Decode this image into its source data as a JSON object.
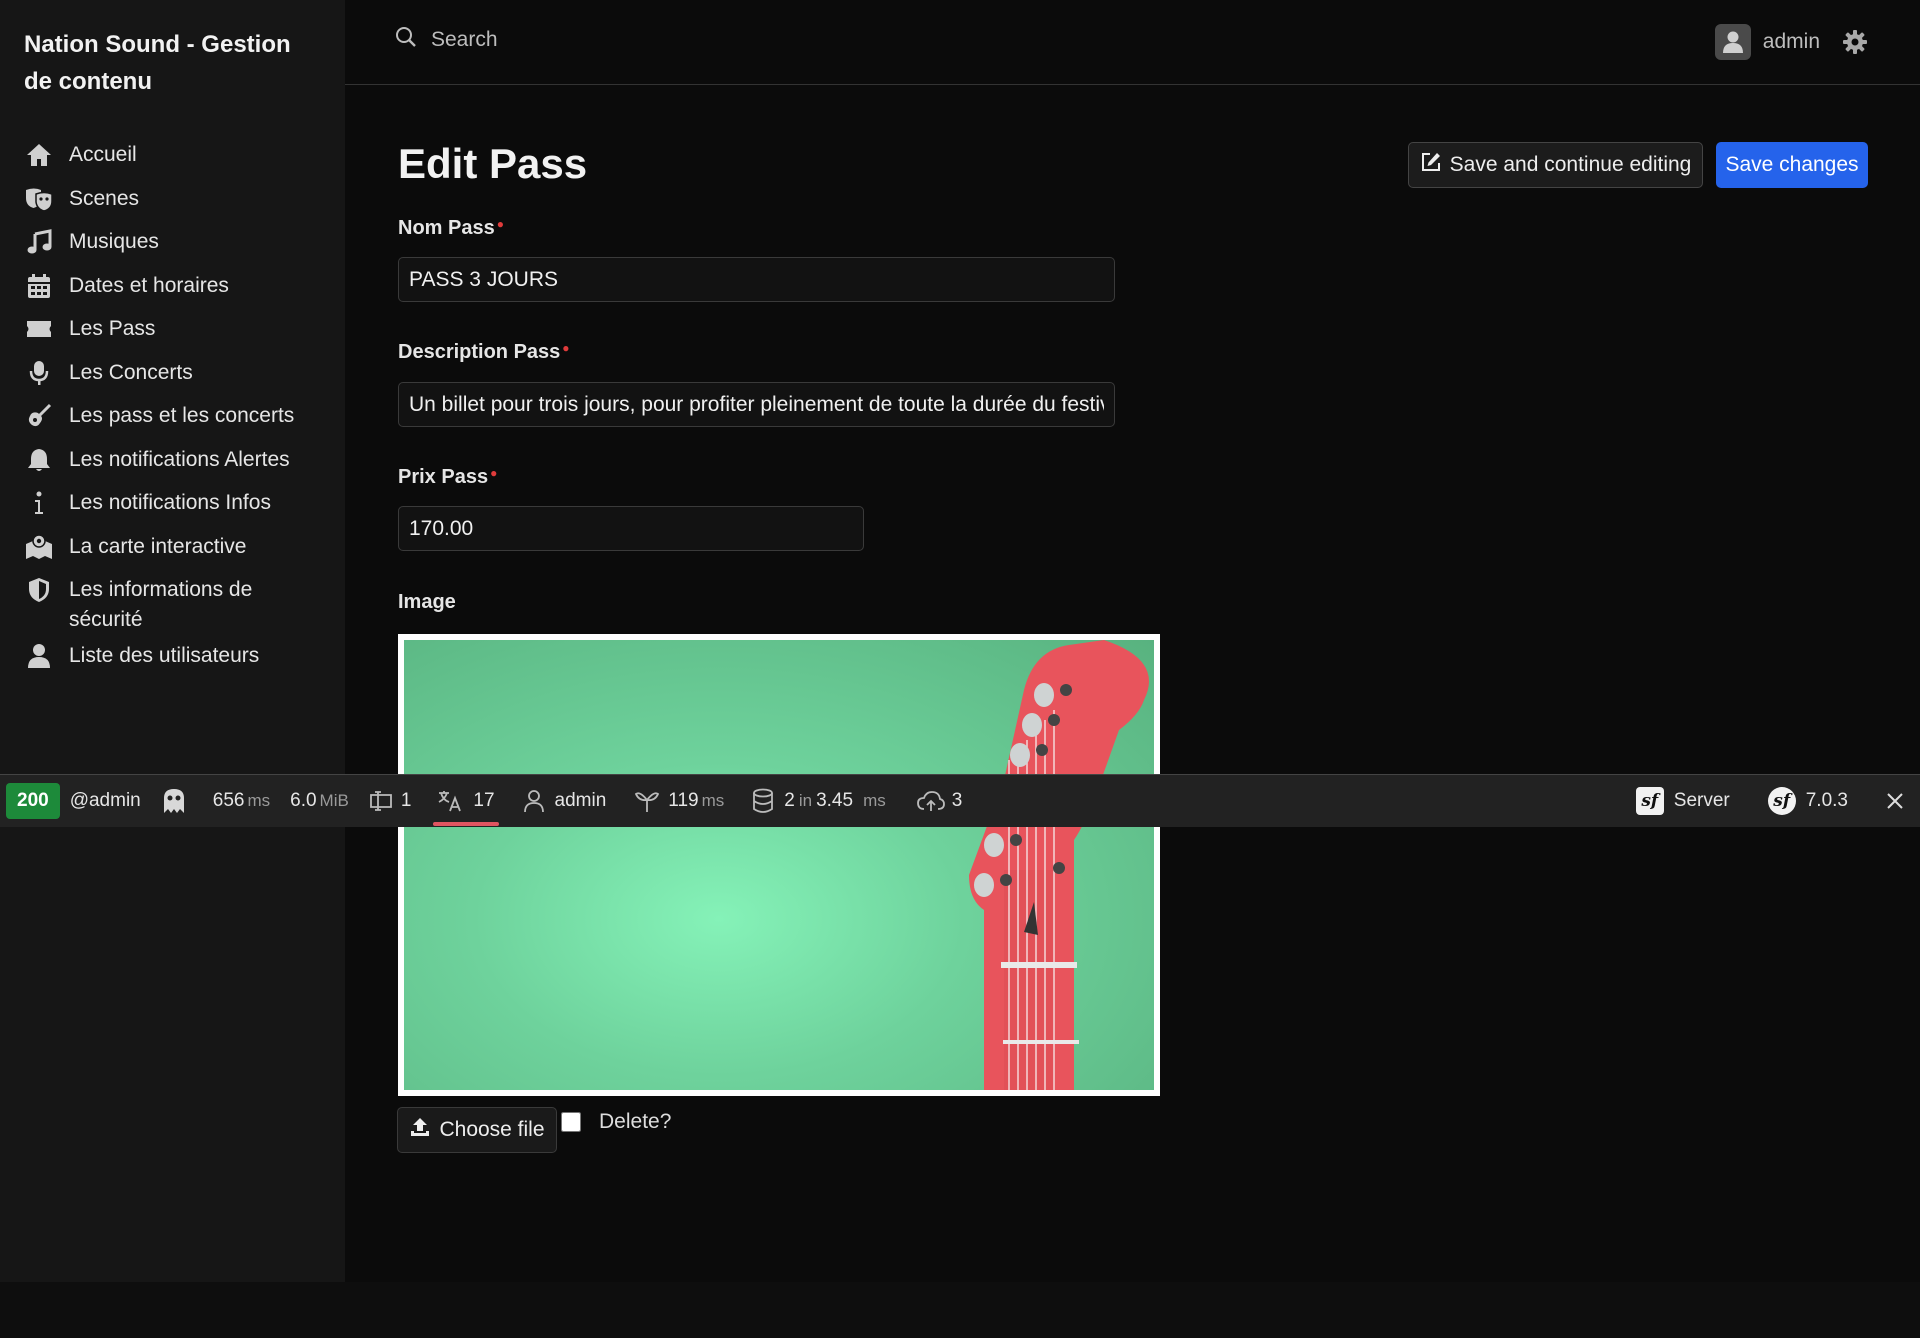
{
  "sidebar": {
    "brand": "Nation Sound - Gestion de contenu",
    "items": [
      {
        "label": "Accueil",
        "icon": "home-icon"
      },
      {
        "label": "Scenes",
        "icon": "masks-icon"
      },
      {
        "label": "Musiques",
        "icon": "music-icon"
      },
      {
        "label": "Dates et horaires",
        "icon": "calendar-icon"
      },
      {
        "label": "Les Pass",
        "icon": "ticket-icon"
      },
      {
        "label": "Les Concerts",
        "icon": "microphone-icon"
      },
      {
        "label": "Les pass et les concerts",
        "icon": "guitar-icon"
      },
      {
        "label": "Les notifications Alertes",
        "icon": "bell-icon"
      },
      {
        "label": "Les notifications Infos",
        "icon": "info-icon"
      },
      {
        "label": "La carte interactive",
        "icon": "map-location-icon"
      },
      {
        "label": "Les informations de sécurité",
        "icon": "shield-icon"
      },
      {
        "label": "Liste des utilisateurs",
        "icon": "user-icon"
      }
    ]
  },
  "header": {
    "search_placeholder": "Search",
    "username": "admin"
  },
  "page": {
    "title": "Edit Pass",
    "save_continue_label": "Save and continue editing",
    "save_label": "Save changes"
  },
  "form": {
    "nom": {
      "label": "Nom Pass",
      "value": "PASS 3 JOURS"
    },
    "description": {
      "label": "Description Pass",
      "value": "Un billet pour trois jours, pour profiter pleinement de toute la durée du festival"
    },
    "prix": {
      "label": "Prix Pass",
      "value": "170.00"
    },
    "image": {
      "label": "Image",
      "choose_label": "Choose file",
      "delete_label": "Delete?"
    }
  },
  "profiler": {
    "status": "200",
    "user_tag": "@admin",
    "time": "656",
    "time_unit": "ms",
    "memory": "6.0",
    "memory_unit": "MiB",
    "forms": "1",
    "translations": "17",
    "user": "admin",
    "twig": "119",
    "twig_unit": "ms",
    "db_count": "2",
    "db_in": "in",
    "db_time": "3.45",
    "db_unit": "ms",
    "http": "3",
    "server_label": "Server",
    "version": "7.0.3"
  },
  "colors": {
    "accent": "#2563eb",
    "status_ok": "#1d8a3a",
    "required": "#e03b3b",
    "active_tab": "#e05561"
  }
}
